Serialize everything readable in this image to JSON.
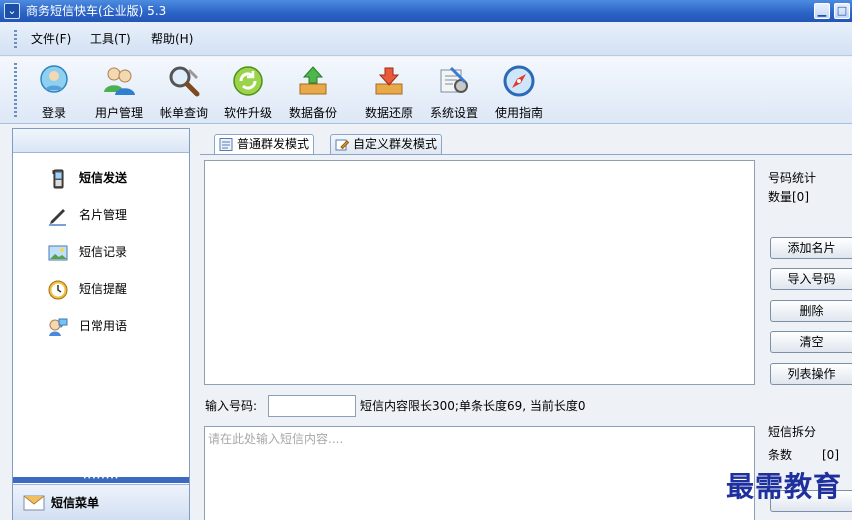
{
  "window": {
    "title": "商务短信快车(企业版) 5.3",
    "minimize_glyph": "▁",
    "maximize_glyph": "□"
  },
  "menu": {
    "items": [
      {
        "label": "文件(F)"
      },
      {
        "label": "工具(T)"
      },
      {
        "label": "帮助(H)"
      }
    ]
  },
  "toolbar": {
    "items": [
      {
        "label": "登录",
        "icon": "login-icon"
      },
      {
        "label": "用户管理",
        "icon": "users-icon"
      },
      {
        "label": "帐单查询",
        "icon": "bill-query-icon"
      },
      {
        "label": "软件升级",
        "icon": "upgrade-icon"
      },
      {
        "label": "数据备份",
        "icon": "backup-icon"
      },
      {
        "label": "数据还原",
        "icon": "restore-icon"
      },
      {
        "label": "系统设置",
        "icon": "settings-icon"
      },
      {
        "label": "使用指南",
        "icon": "compass-icon"
      }
    ],
    "dropdown_glyph": "▾"
  },
  "sidebar": {
    "items": [
      {
        "label": "短信发送",
        "icon": "phone-icon",
        "active": true
      },
      {
        "label": "名片管理",
        "icon": "pen-icon",
        "active": false
      },
      {
        "label": "短信记录",
        "icon": "image-record-icon",
        "active": false
      },
      {
        "label": "短信提醒",
        "icon": "clock-icon",
        "active": false
      },
      {
        "label": "日常用语",
        "icon": "chat-icon",
        "active": false
      }
    ],
    "splitter_dots": "••••••••",
    "footer_label": "短信菜单"
  },
  "tabs": [
    {
      "label": "普通群发模式",
      "active": true
    },
    {
      "label": "自定义群发模式",
      "active": false
    }
  ],
  "stats": {
    "title": "号码统计",
    "count_label": "数量[0]"
  },
  "buttons": {
    "add_card": "添加名片",
    "import": "导入号码",
    "delete": "删除",
    "clear": "清空",
    "list_ops": "列表操作"
  },
  "input": {
    "phone_label": "输入号码:",
    "phone_value": "",
    "limit_text": "短信内容限长300;单条长度69, 当前长度0",
    "content_placeholder": "请在此处输入短信内容....",
    "content_value": ""
  },
  "split": {
    "title": "短信拆分",
    "count_label": "条数",
    "count_value": "[0]"
  },
  "watermark": "最需教育",
  "colors": {
    "titlebar": "#2a63c6",
    "accent": "#3a6bc0",
    "watermark": "#1e2f9e"
  }
}
